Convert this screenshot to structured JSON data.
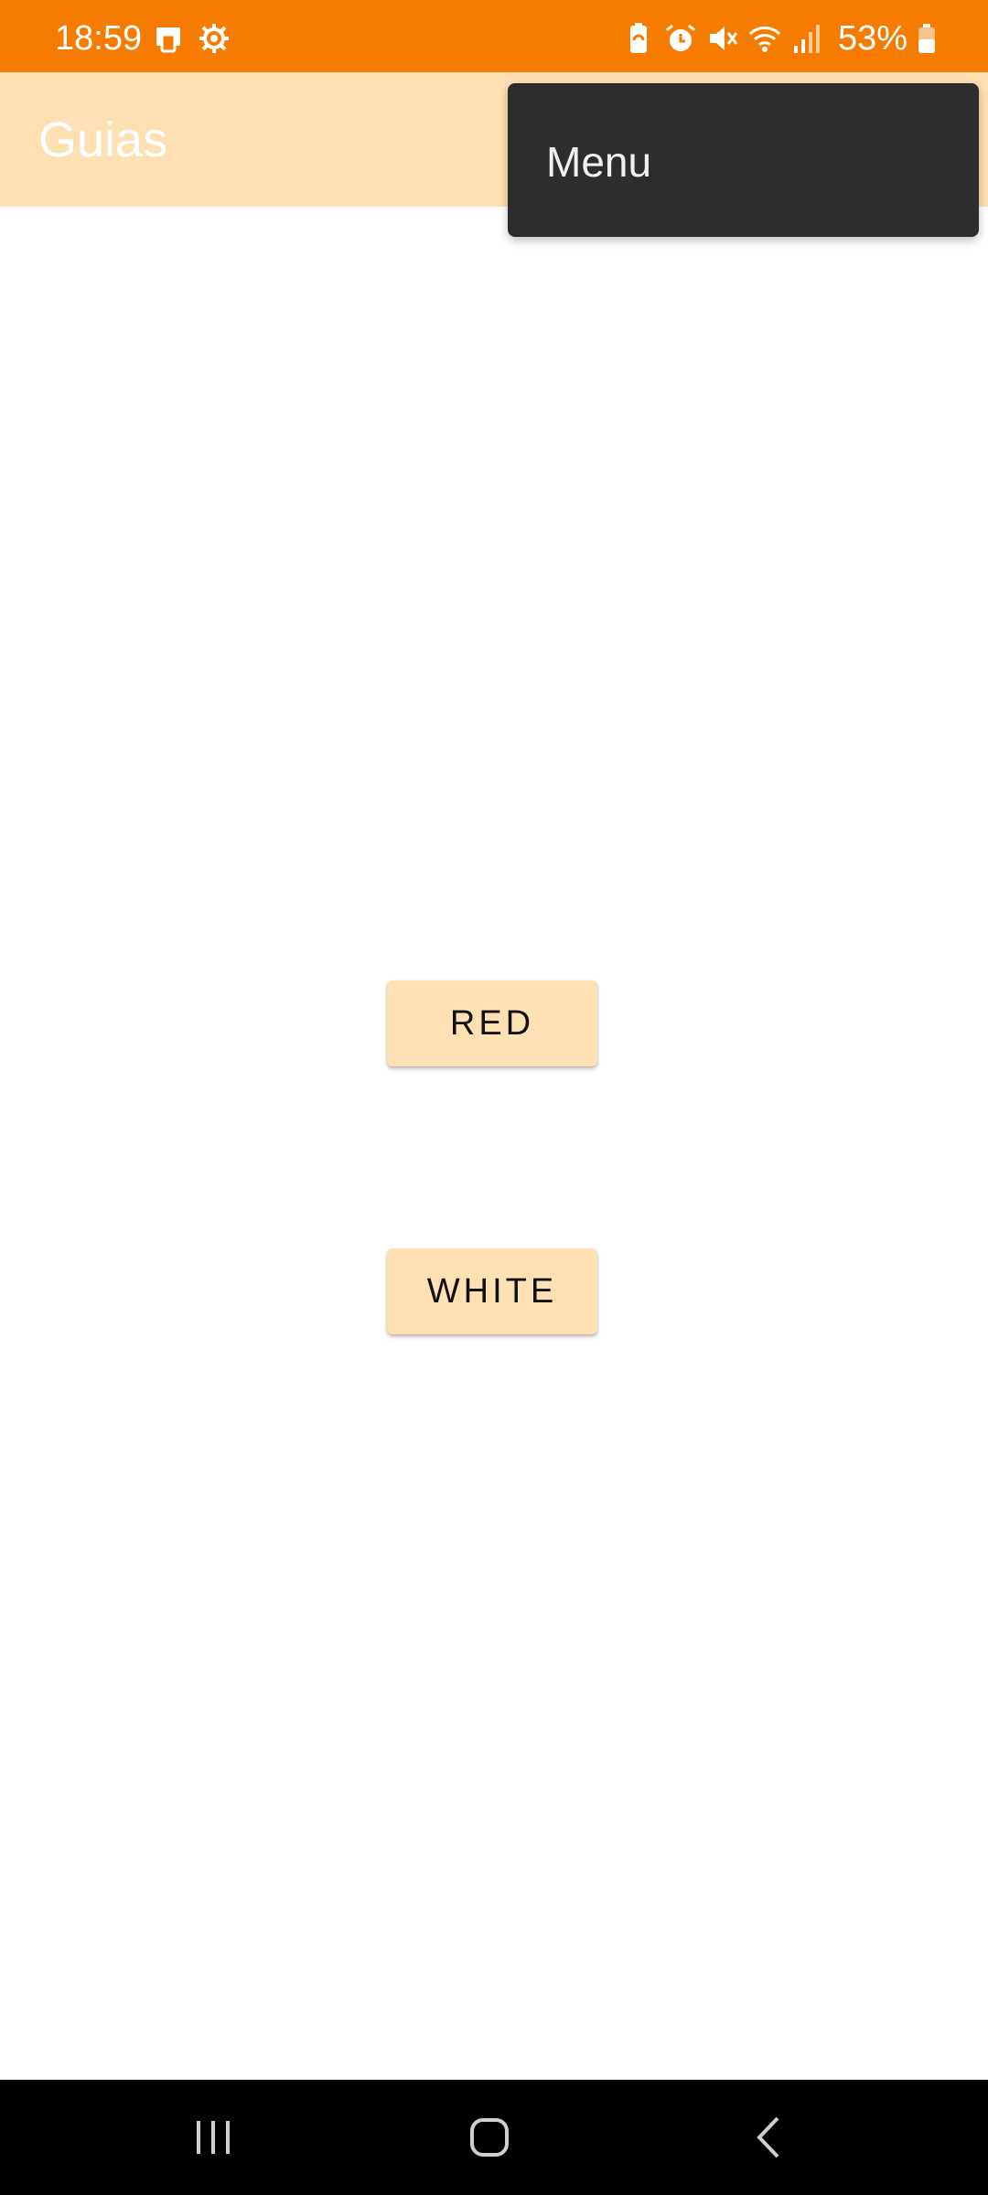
{
  "status_bar": {
    "time": "18:59",
    "battery_text": "53%",
    "left_icons": [
      "screen-share-icon",
      "settings-gear-icon"
    ],
    "right_icons": [
      "battery-saver-icon",
      "alarm-icon",
      "mute-icon",
      "wifi-icon",
      "signal-icon",
      "battery-icon"
    ],
    "background": "#f57c00"
  },
  "app_bar": {
    "title": "Guias",
    "background": "#ffe0b2"
  },
  "popup_menu": {
    "items": [
      {
        "label": "Menu"
      }
    ],
    "background": "#2d2d2d"
  },
  "main": {
    "buttons": [
      {
        "label": "RED"
      },
      {
        "label": "WHITE"
      }
    ],
    "button_color": "#ffe0b2"
  },
  "nav_bar": {
    "buttons": [
      "recents-icon",
      "home-icon",
      "back-icon"
    ],
    "background": "#000000"
  }
}
